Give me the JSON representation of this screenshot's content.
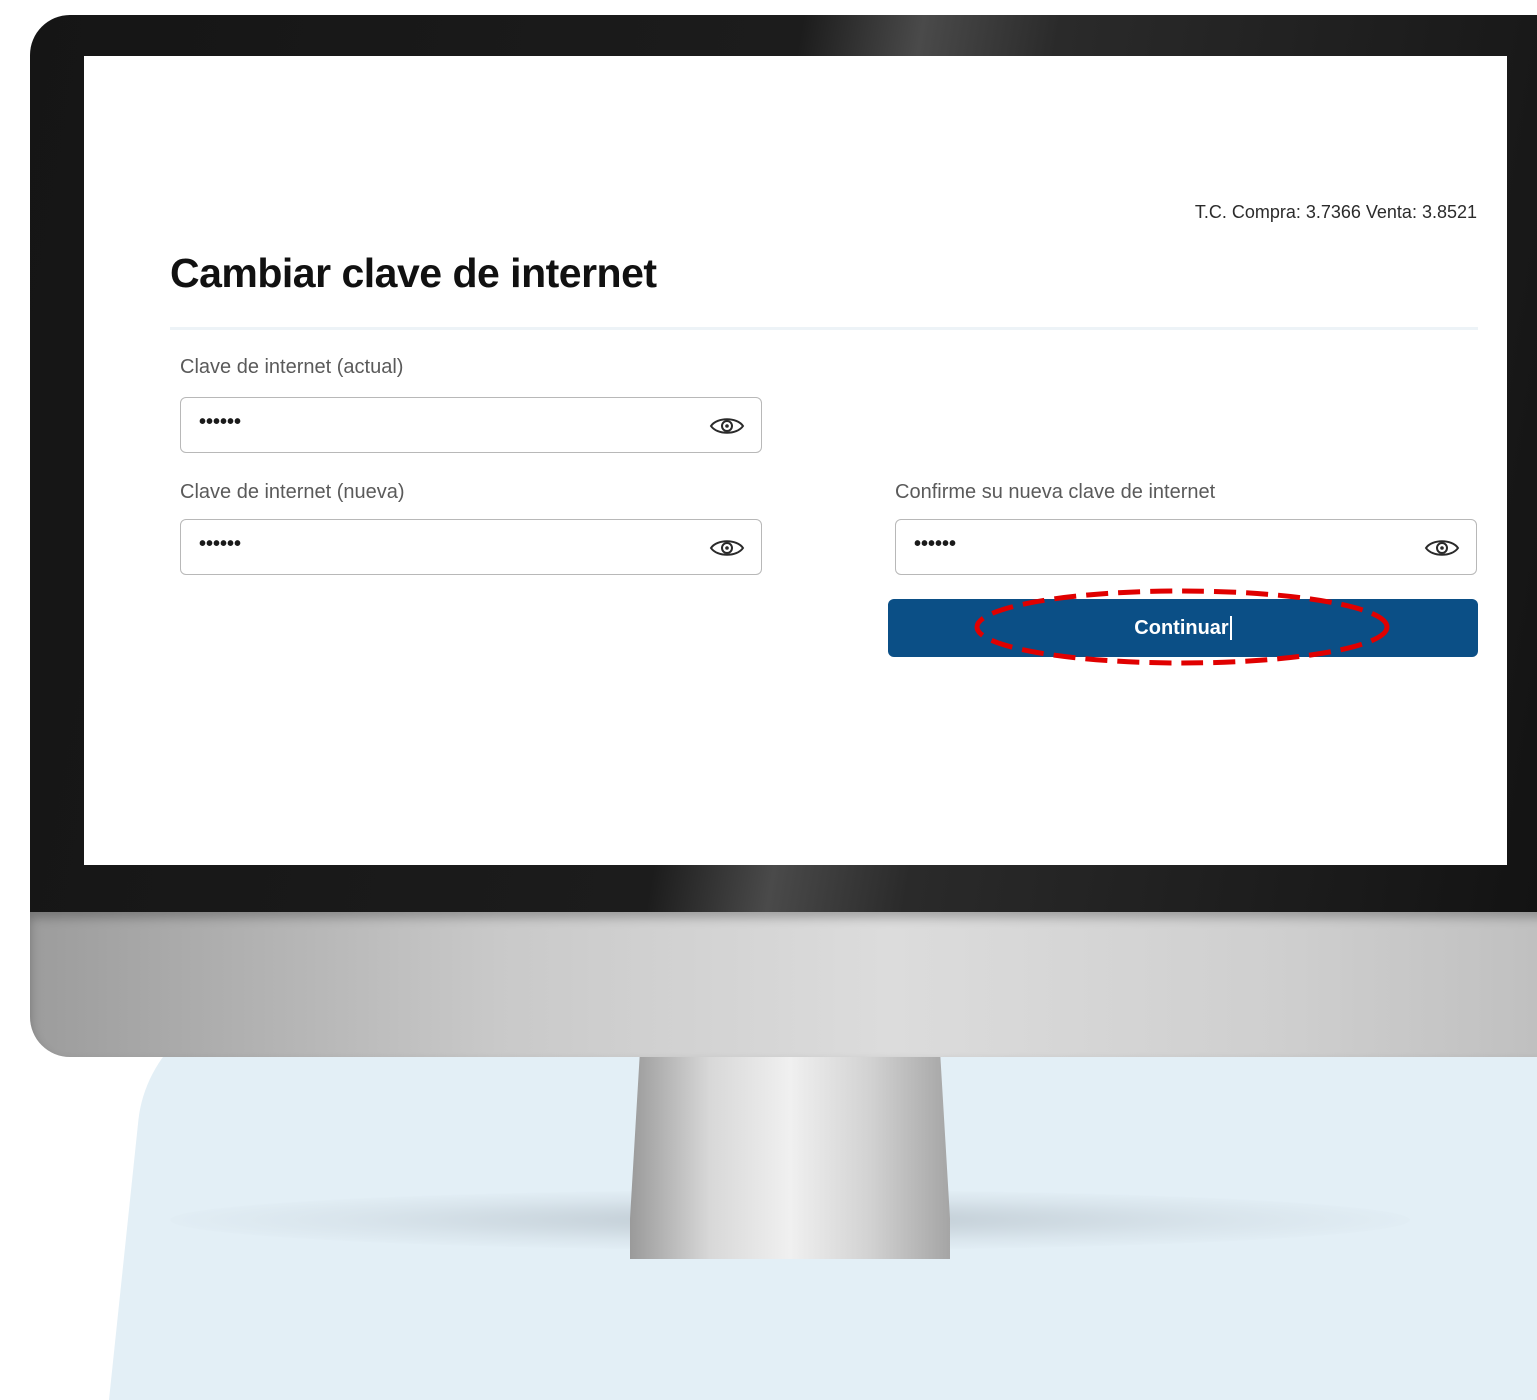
{
  "exchange_rate": "T.C. Compra: 3.7366 Venta: 3.8521",
  "page": {
    "title": "Cambiar clave de internet"
  },
  "form": {
    "current_password": {
      "label": "Clave de internet (actual)",
      "value": "••••••",
      "icon": "eye-icon"
    },
    "new_password": {
      "label": "Clave de internet (nueva)",
      "value": "••••••",
      "icon": "eye-icon"
    },
    "confirm_password": {
      "label": "Confirme su nueva clave de internet",
      "value": "••••••",
      "icon": "eye-icon"
    },
    "continue_label": "Continuar"
  },
  "colors": {
    "primary_button": "#0b4f86",
    "highlight": "#e00000",
    "backdrop": "#e3eff6"
  }
}
